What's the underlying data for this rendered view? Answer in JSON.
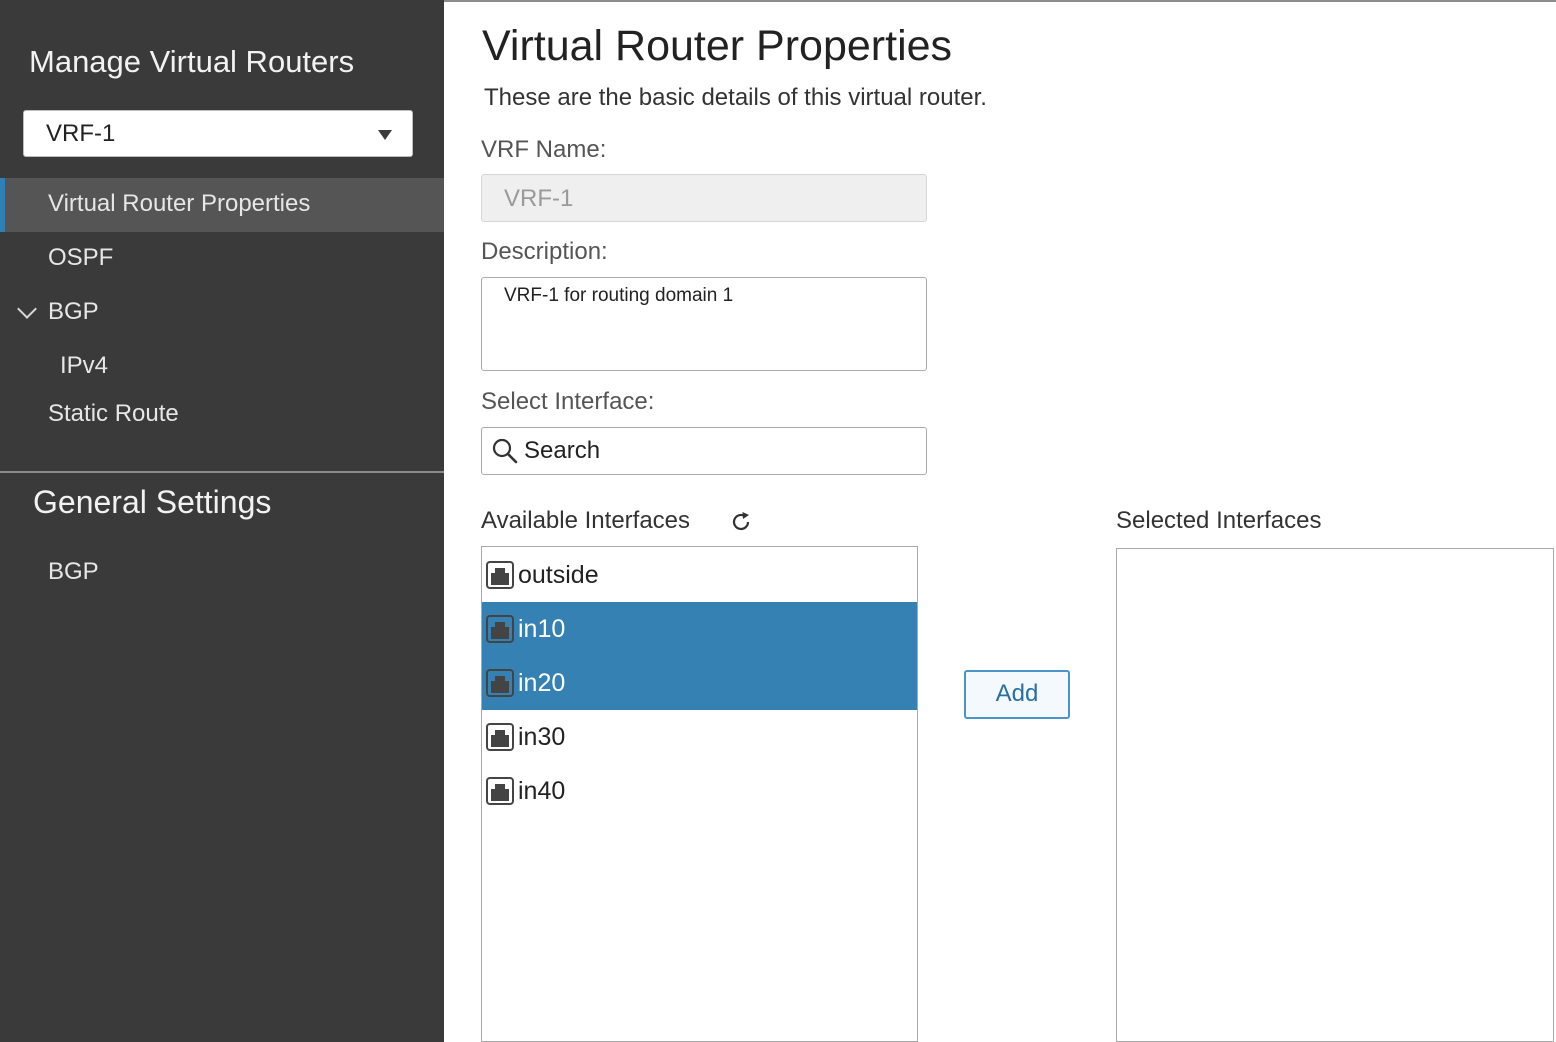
{
  "sidebar": {
    "title": "Manage Virtual Routers",
    "vrf_select": {
      "value": "VRF-1"
    },
    "nav": [
      {
        "label": "Virtual Router Properties",
        "active": true
      },
      {
        "label": "OSPF"
      },
      {
        "label": "BGP",
        "expanded": true
      },
      {
        "label": "IPv4"
      },
      {
        "label": "Static Route"
      }
    ],
    "general_settings": {
      "title": "General Settings",
      "items": [
        {
          "label": "BGP"
        }
      ]
    }
  },
  "main": {
    "title": "Virtual Router Properties",
    "subtitle": "These are the basic details of this virtual router.",
    "vrf_name": {
      "label": "VRF Name:",
      "value": "VRF-1"
    },
    "description": {
      "label": "Description:",
      "value": "VRF-1 for routing domain 1"
    },
    "select_interface": {
      "label": "Select Interface:",
      "placeholder": "Search"
    },
    "available": {
      "label": "Available Interfaces",
      "items": [
        {
          "name": "outside",
          "selected": false
        },
        {
          "name": "in10",
          "selected": true
        },
        {
          "name": "in20",
          "selected": true
        },
        {
          "name": "in30",
          "selected": false
        },
        {
          "name": "in40",
          "selected": false
        }
      ]
    },
    "add_button": "Add",
    "selected": {
      "label": "Selected Interfaces",
      "items": []
    }
  },
  "colors": {
    "sidebar_bg": "#3a3a3a",
    "active_nav_bg": "#555555",
    "accent": "#2f7fb8",
    "selection": "#3681b3"
  }
}
